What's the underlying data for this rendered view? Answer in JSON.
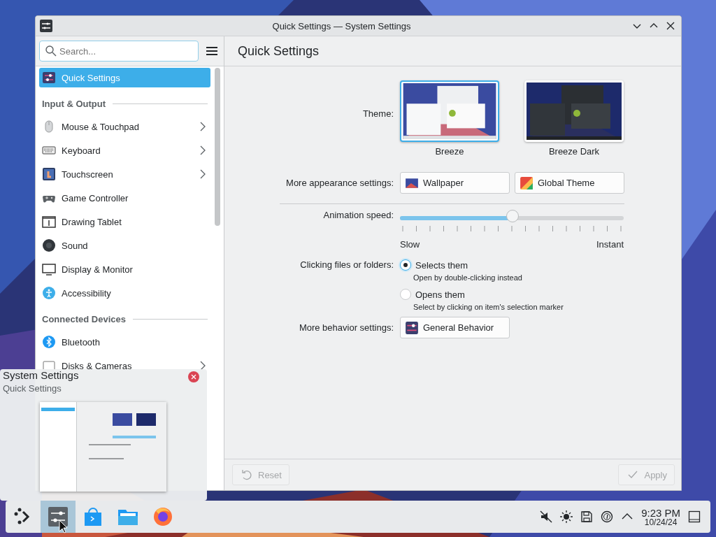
{
  "window": {
    "title": "Quick Settings — System Settings"
  },
  "sidebar": {
    "search": {
      "placeholder": "Search..."
    },
    "items": [
      {
        "kind": "item",
        "label": "Quick Settings",
        "selected": true,
        "has_children": false
      },
      {
        "kind": "section",
        "label": "Input & Output"
      },
      {
        "kind": "item",
        "label": "Mouse & Touchpad",
        "selected": false,
        "has_children": true
      },
      {
        "kind": "item",
        "label": "Keyboard",
        "selected": false,
        "has_children": true
      },
      {
        "kind": "item",
        "label": "Touchscreen",
        "selected": false,
        "has_children": true
      },
      {
        "kind": "item",
        "label": "Game Controller",
        "selected": false,
        "has_children": false
      },
      {
        "kind": "item",
        "label": "Drawing Tablet",
        "selected": false,
        "has_children": false
      },
      {
        "kind": "item",
        "label": "Sound",
        "selected": false,
        "has_children": false
      },
      {
        "kind": "item",
        "label": "Display & Monitor",
        "selected": false,
        "has_children": false
      },
      {
        "kind": "item",
        "label": "Accessibility",
        "selected": false,
        "has_children": false
      },
      {
        "kind": "section",
        "label": "Connected Devices"
      },
      {
        "kind": "item",
        "label": "Bluetooth",
        "selected": false,
        "has_children": false
      },
      {
        "kind": "item",
        "label": "Disks & Cameras",
        "selected": false,
        "has_children": true
      }
    ]
  },
  "page": {
    "title": "Quick Settings",
    "theme": {
      "label": "Theme:",
      "options": [
        {
          "label": "Breeze",
          "selected": true
        },
        {
          "label": "Breeze Dark",
          "selected": false
        }
      ]
    },
    "appearance": {
      "label": "More appearance settings:",
      "buttons": [
        "Wallpaper",
        "Global Theme"
      ]
    },
    "animation": {
      "label": "Animation speed:",
      "level": 0.5,
      "min_label": "Slow",
      "max_label": "Instant"
    },
    "clicking": {
      "label": "Clicking files or folders:",
      "options": [
        {
          "label": "Selects them",
          "description": "Open by double-clicking instead",
          "selected": true
        },
        {
          "label": "Opens them",
          "description": "Select by clicking on item's selection marker",
          "selected": false
        }
      ]
    },
    "behavior": {
      "label": "More behavior settings:",
      "buttons": [
        "General Behavior"
      ]
    },
    "footer": [
      {
        "label": "Reset",
        "kind": "reset",
        "disabled": true
      },
      {
        "label": "Apply",
        "kind": "apply",
        "disabled": true
      }
    ]
  },
  "tooltip": {
    "title": "System Settings",
    "subtitle": "Quick Settings"
  },
  "taskbar": {
    "apps": [
      {
        "selected": false
      },
      {
        "selected": true
      },
      {
        "selected": false
      },
      {
        "selected": false
      },
      {
        "selected": false
      }
    ],
    "clock": {
      "time": "9:23 PM",
      "date": "10/24/24"
    }
  }
}
